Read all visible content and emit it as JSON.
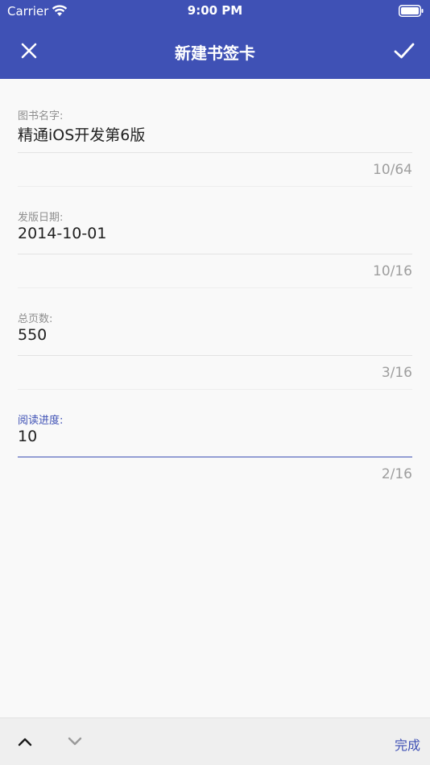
{
  "status_bar": {
    "carrier": "Carrier",
    "time": "9:00 PM"
  },
  "appbar": {
    "title": "新建书签卡",
    "close_icon": "close-icon",
    "confirm_icon": "check-icon"
  },
  "form": {
    "fields": [
      {
        "label": "图书名字:",
        "value": "精通iOS开发第6版",
        "counter": "10/64"
      },
      {
        "label": "发版日期:",
        "value": "2014-10-01",
        "counter": "10/16"
      },
      {
        "label": "总页数:",
        "value": "550",
        "counter": "3/16"
      },
      {
        "label": "阅读进度:",
        "value": "10",
        "counter": "2/16"
      }
    ]
  },
  "keyboard_toolbar": {
    "prev_icon": "chevron-up-icon",
    "next_icon": "chevron-down-icon",
    "done_label": "完成"
  },
  "colors": {
    "primary": "#3f51b5",
    "background": "#f9f9f9",
    "toolbar": "#efefef"
  }
}
